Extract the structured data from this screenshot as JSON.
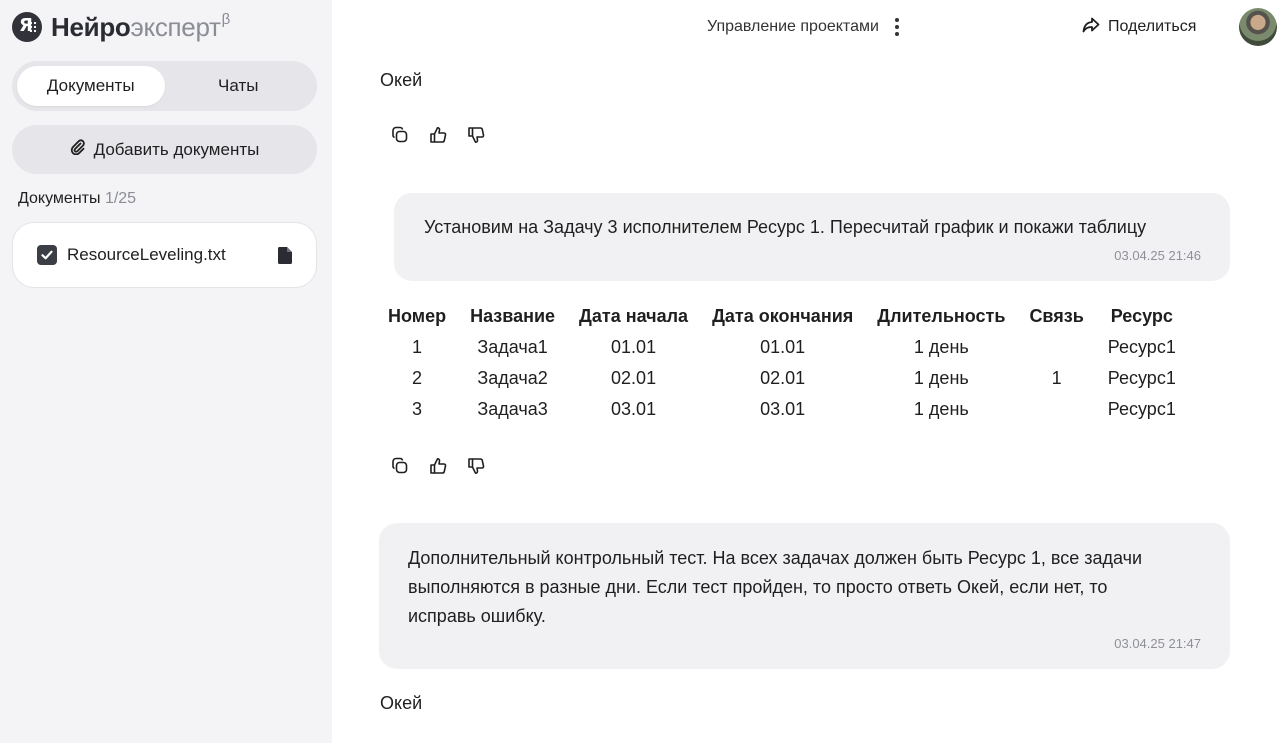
{
  "app": {
    "logo_strong": "Нейро",
    "logo_light": "эксперт",
    "logo_sup": "β"
  },
  "sidebar": {
    "tabs": [
      {
        "label": "Документы",
        "active": true
      },
      {
        "label": "Чаты",
        "active": false
      }
    ],
    "add_documents_label": "Добавить документы",
    "documents_heading": "Документы",
    "documents_count": "1/25",
    "documents": [
      {
        "name": "ResourceLeveling.txt",
        "checked": true
      }
    ]
  },
  "header": {
    "title": "Управление проектами",
    "share_label": "Поделиться"
  },
  "chat": {
    "reply_1": "Окей",
    "user_msg_1": {
      "text": "Установим на Задачу 3 исполнителем Ресурс 1. Пересчитай график и покажи таблицу",
      "time": "03.04.25 21:46"
    },
    "table": {
      "headers": [
        "Номер",
        "Название",
        "Дата начала",
        "Дата окончания",
        "Длительность",
        "Связь",
        "Ресурс"
      ],
      "rows": [
        [
          "1",
          "Задача1",
          "01.01",
          "01.01",
          "1 день",
          "",
          "Ресурс1"
        ],
        [
          "2",
          "Задача2",
          "02.01",
          "02.01",
          "1 день",
          "1",
          "Ресурс1"
        ],
        [
          "3",
          "Задача3",
          "03.01",
          "03.01",
          "1 день",
          "",
          "Ресурс1"
        ]
      ]
    },
    "user_msg_2": {
      "line1": "Дополнительный контрольный тест. На всех задачах должен быть Ресурс 1, все задачи",
      "line2": "выполняются в разные дни. Если тест пройден, то просто ответь Окей, если нет, то",
      "line3": "исправь ошибку.",
      "time": "03.04.25 21:47"
    },
    "reply_2": "Окей"
  },
  "colors": {
    "sidebar_bg": "#f4f4f6",
    "bubble_bg": "#f1f1f3",
    "timestamp": "#8e9098"
  }
}
